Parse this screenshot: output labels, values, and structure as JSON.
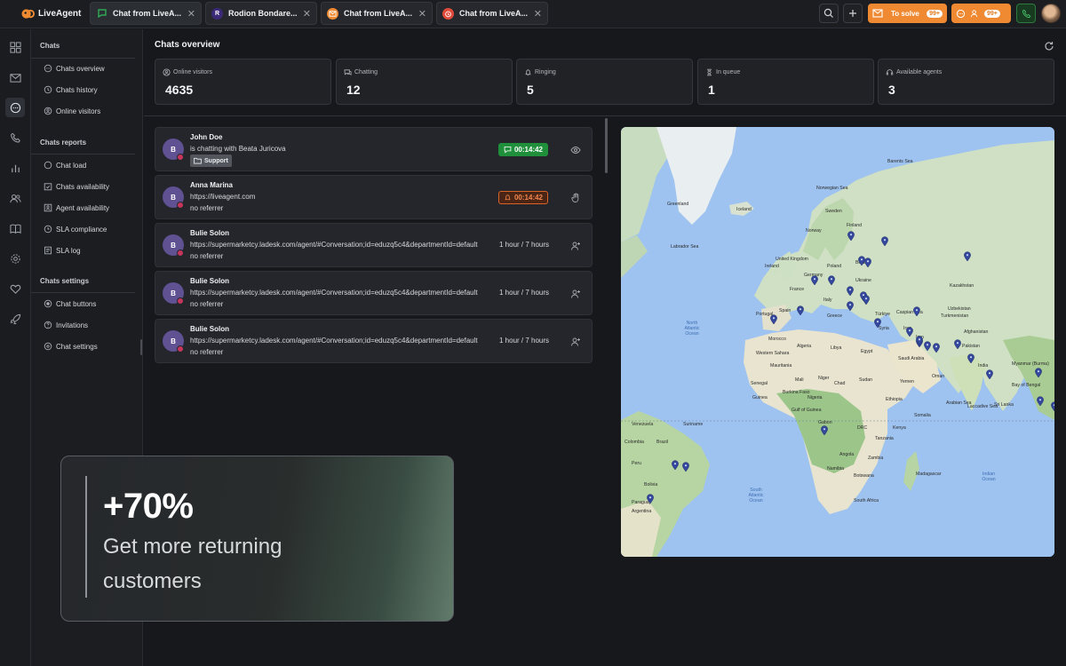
{
  "app": {
    "name": "LiveAgent"
  },
  "tabs": [
    {
      "label": "Chat from LiveA...",
      "icon": "chat-icon",
      "color": "#1e8f3e"
    },
    {
      "label": "Rodion Bondare...",
      "icon": "avatar-r",
      "initial": "R",
      "color": "#5b3da6"
    },
    {
      "label": "Chat from LiveA...",
      "icon": "mail-chat-icon",
      "color": "#f08a32"
    },
    {
      "label": "Chat from LiveA...",
      "icon": "alarm-icon",
      "color": "#e04a3a"
    }
  ],
  "topbar": {
    "to_solve_label": "To solve",
    "to_solve_count": "99+",
    "chats_count": "99+"
  },
  "sidebar": {
    "sections": [
      {
        "title": "Chats",
        "items": [
          "Chats overview",
          "Chats history",
          "Online visitors"
        ]
      },
      {
        "title": "Chats reports",
        "items": [
          "Chat load",
          "Chats availability",
          "Agent availability",
          "SLA compliance",
          "SLA log"
        ]
      },
      {
        "title": "Chats settings",
        "items": [
          "Chat buttons",
          "Invitations",
          "Chat settings"
        ]
      }
    ]
  },
  "main": {
    "title": "Chats overview",
    "stats": [
      {
        "label": "Online visitors",
        "value": "4635",
        "icon": "user-circle-icon"
      },
      {
        "label": "Chatting",
        "value": "12",
        "icon": "chat-bubbles-icon"
      },
      {
        "label": "Ringing",
        "value": "5",
        "icon": "bell-icon"
      },
      {
        "label": "In queue",
        "value": "1",
        "icon": "hourglass-icon"
      },
      {
        "label": "Available agents",
        "value": "3",
        "icon": "headset-icon"
      }
    ],
    "chats": [
      {
        "avatar": "B",
        "name": "John Doe",
        "line2": "is chatting with Beata Juricova",
        "tag": "Support",
        "timer": "00:14:42",
        "status": "chatting"
      },
      {
        "avatar": "B",
        "name": "Anna Marina",
        "line2": "https://liveagent.com",
        "line3": "no referrer",
        "timer": "00:14:42",
        "status": "ringing"
      },
      {
        "avatar": "B",
        "name": "Bulie Solon",
        "line2": "https://supermarketcy.ladesk.com/agent/#Conversation;id=eduzq5c4&departmentId=default",
        "line3": "no referrer",
        "duration": "1 hour / 7  hours"
      },
      {
        "avatar": "B",
        "name": "Bulie Solon",
        "line2": "https://supermarketcy.ladesk.com/agent/#Conversation;id=eduzq5c4&departmentId=default",
        "line3": "no referrer",
        "duration": "1 hour / 7  hours"
      },
      {
        "avatar": "B",
        "name": "Bulie Solon",
        "line2": "https://supermarketcy.ladesk.com/agent/#Conversation;id=eduzq5c4&departmentId=default",
        "line3": "no referrer",
        "duration": "1 hour / 7  hours"
      }
    ]
  },
  "map": {
    "labels": [
      "Greenland",
      "Iceland",
      "Sweden",
      "Finland",
      "Norway",
      "United Kingdom",
      "Ireland",
      "Poland",
      "Belarus",
      "Ukraine",
      "Germany",
      "France",
      "Spain",
      "Portugal",
      "Italy",
      "Greece",
      "Türkiye",
      "Syria",
      "Iraq",
      "Iran",
      "Turkmenistan",
      "Kazakhstan",
      "Uzbekistan",
      "Afghanistan",
      "Pakistan",
      "India",
      "Myanmar (Burma)",
      "Morocco",
      "Algeria",
      "Libya",
      "Egypt",
      "Saudi Arabia",
      "Oman",
      "Yemen",
      "Mali",
      "Niger",
      "Chad",
      "Sudan",
      "Ethiopia",
      "Somalia",
      "Kenya",
      "Tanzania",
      "DRC",
      "Angola",
      "Zambia",
      "Namibia",
      "Botswana",
      "Madagascar",
      "South Africa",
      "Nigeria",
      "Gabon",
      "Mauritania",
      "Senegal",
      "Guinea",
      "Burkina Faso",
      "Brazil",
      "Peru",
      "Bolivia",
      "Paraguay",
      "Argentina",
      "Venezuela",
      "Colombia",
      "Suriname",
      "Western Sahara",
      "Sri Lanka",
      "Labrador Sea",
      "Norwegian Sea",
      "Barents Sea",
      "Caspian Sea",
      "Arabian Sea",
      "Bay of Bengal",
      "Laccadive Sea",
      "Gulf of Guinea"
    ],
    "oceans": [
      "North Atlantic Ocean",
      "South Atlantic Ocean",
      "Indian Ocean"
    ]
  },
  "promo": {
    "headline": "+70%",
    "text": "Get more returning customers"
  }
}
